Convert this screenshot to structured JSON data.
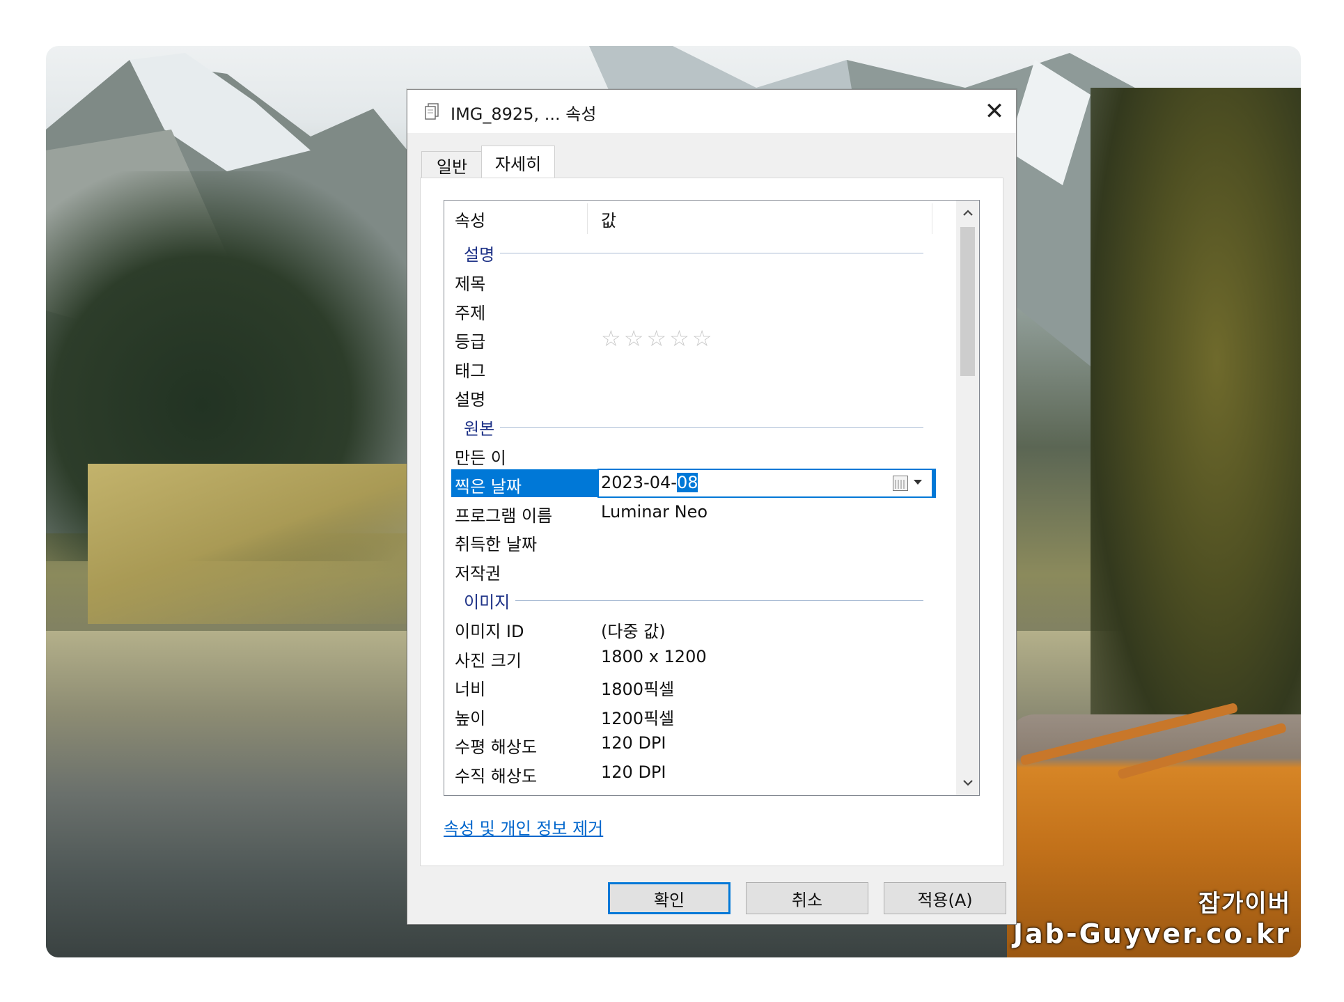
{
  "watermark": {
    "line1": "잡가이버",
    "line2": "Jab-Guyver.co.kr"
  },
  "dialog": {
    "title": "IMG_8925, ... 속성",
    "close_label": "✕",
    "tabs": [
      {
        "label": "일반"
      },
      {
        "label": "자세히"
      }
    ],
    "active_tab": "자세히",
    "list": {
      "header": {
        "property": "속성",
        "value": "값"
      },
      "groups": [
        {
          "label": "설명",
          "rows": [
            {
              "key": "제목",
              "value": ""
            },
            {
              "key": "주제",
              "value": ""
            },
            {
              "key": "등급",
              "value": "",
              "stars": "☆☆☆☆☆",
              "rating": 0
            },
            {
              "key": "태그",
              "value": ""
            },
            {
              "key": "설명",
              "value": ""
            }
          ]
        },
        {
          "label": "원본",
          "rows": [
            {
              "key": "만든 이",
              "value": ""
            },
            {
              "key": "찍은 날짜",
              "value_prefix": "2023-04-",
              "value_selected": "08",
              "selected": true
            },
            {
              "key": "프로그램 이름",
              "value": "Luminar Neo"
            },
            {
              "key": "취득한 날짜",
              "value": ""
            },
            {
              "key": "저작권",
              "value": ""
            }
          ]
        },
        {
          "label": "이미지",
          "rows": [
            {
              "key": "이미지 ID",
              "value": "(다중 값)"
            },
            {
              "key": "사진 크기",
              "value": "1800 x 1200"
            },
            {
              "key": "너비",
              "value": "1800픽셀"
            },
            {
              "key": "높이",
              "value": "1200픽셀"
            },
            {
              "key": "수평 해상도",
              "value": "120 DPI"
            },
            {
              "key": "수직 해상도",
              "value": "120 DPI"
            }
          ]
        }
      ],
      "scroll_up": "⌃",
      "scroll_down": "⌄"
    },
    "remove_link": "속성 및 개인 정보 제거",
    "buttons": {
      "ok": "확인",
      "cancel": "취소",
      "apply": "적용(A)"
    }
  },
  "colors": {
    "accent": "#0078d7",
    "group_label": "#1e3287",
    "link": "#0066cc"
  }
}
